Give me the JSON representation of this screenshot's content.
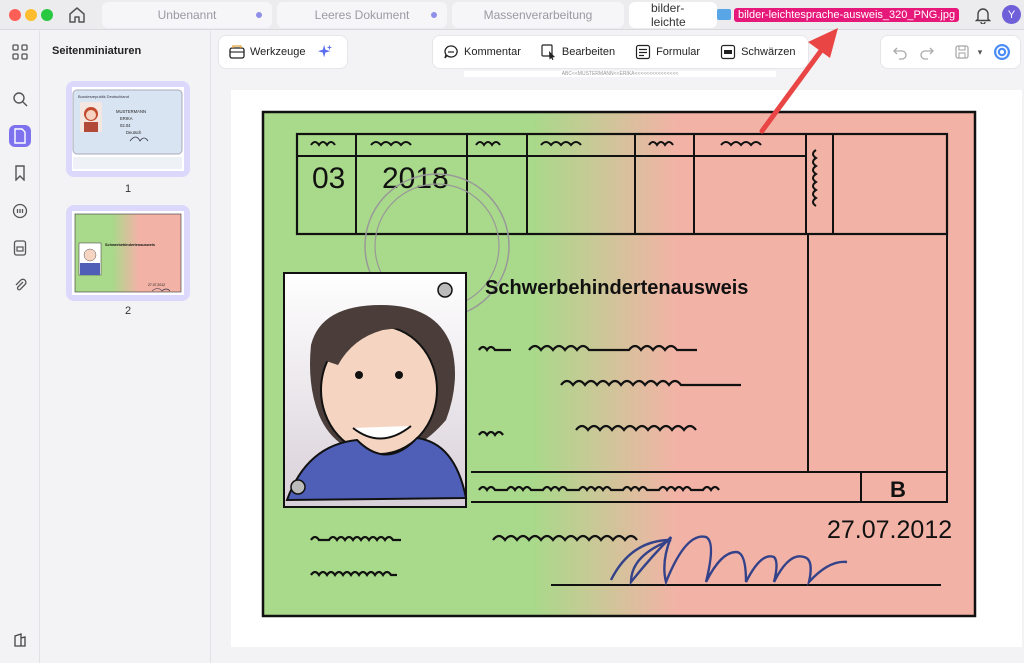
{
  "tabs": [
    {
      "label": "Unbenannt"
    },
    {
      "label": "Leeres Dokument"
    },
    {
      "label": "Massenverarbeitung"
    },
    {
      "label": "bilder-leichte"
    }
  ],
  "file_name": "bilder-leichtesprache-ausweis_320_PNG.jpg",
  "user_initial": "Y",
  "sidebar": {
    "title": "Seitenminiaturen",
    "pages": [
      "1",
      "2"
    ]
  },
  "toolbar": {
    "werkzeuge": "Werkzeuge",
    "kommentar": "Kommentar",
    "bearbeiten": "Bearbeiten",
    "formular": "Formular",
    "schwaerzen": "Schwärzen"
  },
  "document": {
    "month": "03",
    "year": "2018",
    "card_title": "Schwerbehindertenausweis",
    "mark": "B",
    "date": "27.07.2012",
    "top_strip": "ABC<<MUSTERMANN<<ERIKA<<<<<<<<<<<<<<<"
  },
  "thumb1": {
    "country": "Bundesrepublik Deutschland",
    "name1": "MUSTERMANN",
    "name2": "ERIKA",
    "date": "02.04",
    "nationality": "Deutsch"
  },
  "thumb2": {
    "title": "Schwerbehindertenausweis",
    "date": "27.07.2012"
  },
  "colors": {
    "accent": "#7e72ee",
    "card_green": "#a9d98a",
    "card_red": "#f2b3a6",
    "annotation": "#e6197a"
  }
}
